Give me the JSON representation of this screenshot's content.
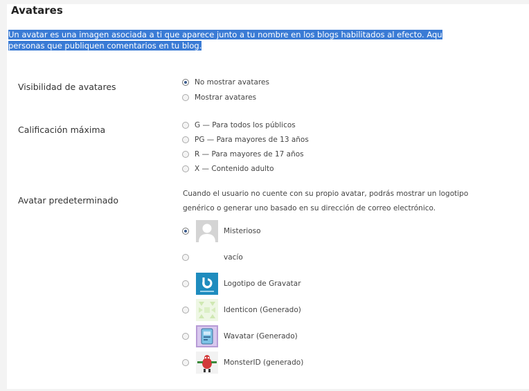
{
  "title": "Avatares",
  "description": {
    "line1": "Un avatar es una imagen asociada a ti que aparece junto a tu nombre en los blogs habilitados al efecto. Aqu",
    "line2": "personas que publiquen comentarios en tu blog."
  },
  "visibility": {
    "label": "Visibilidad de avatares",
    "options": [
      "No mostrar avatares",
      "Mostrar avatares"
    ],
    "selected_index": 0
  },
  "rating": {
    "label": "Calificación máxima",
    "options": [
      "G — Para todos los públicos",
      "PG — Para mayores de 13 años",
      "R — Para mayores de 17 años",
      "X — Contenido adulto"
    ]
  },
  "default_avatar": {
    "label": "Avatar predeterminado",
    "description_line1": "Cuando el usuario no cuente con su propio avatar, podrás mostrar un logotipo",
    "description_line2": "genérico o generar uno basado en su dirección de correo electrónico.",
    "options": [
      {
        "label": "Misterioso",
        "icon": "mystery-person-icon",
        "selected": true
      },
      {
        "label": "vacío",
        "icon": "blank-icon",
        "selected": false
      },
      {
        "label": "Logotipo de Gravatar",
        "icon": "gravatar-logo-icon",
        "selected": false
      },
      {
        "label": "Identicon (Generado)",
        "icon": "identicon-icon",
        "selected": false
      },
      {
        "label": "Wavatar (Generado)",
        "icon": "wavatar-icon",
        "selected": false
      },
      {
        "label": "MonsterID (generado)",
        "icon": "monsterid-icon",
        "selected": false
      }
    ]
  },
  "colors": {
    "selection_highlight": "#3a7bd5",
    "gravatar_blue": "#1e8cbe"
  }
}
